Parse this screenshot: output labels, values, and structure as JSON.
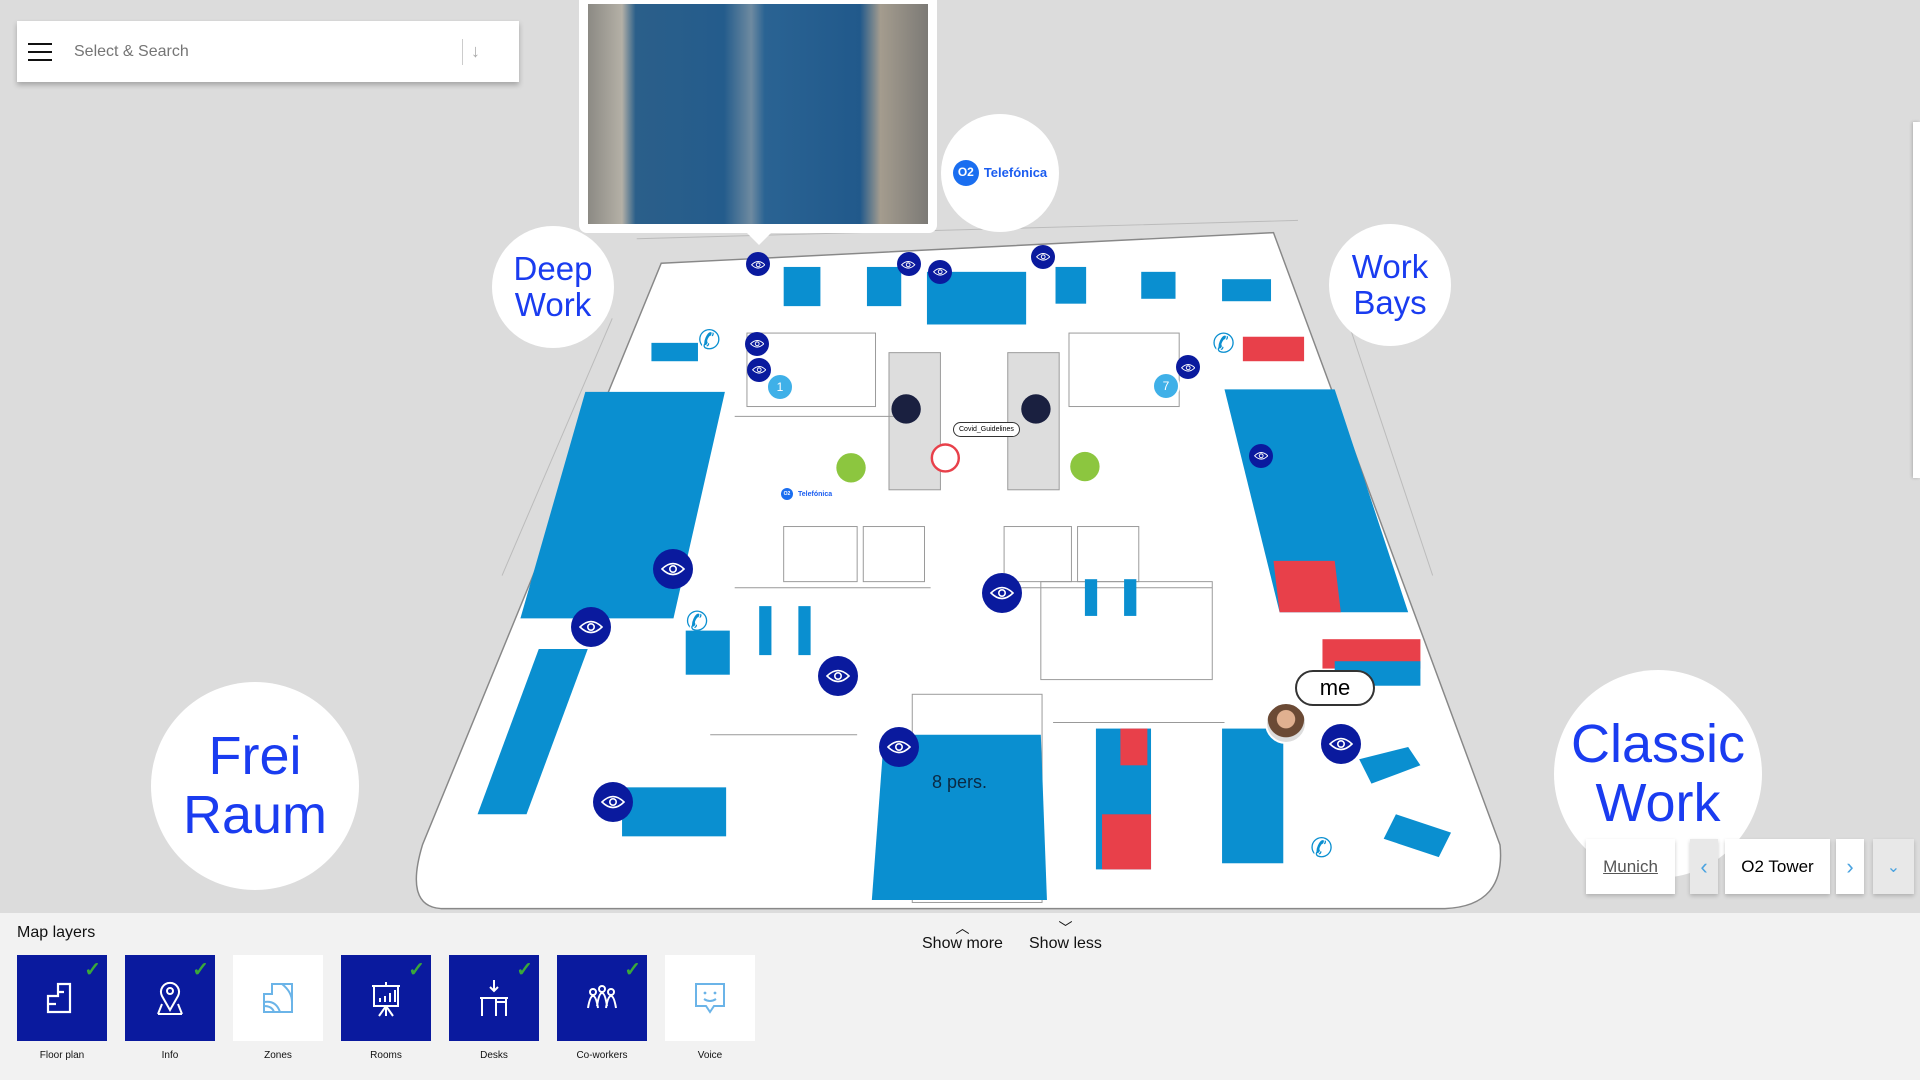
{
  "search": {
    "placeholder": "Select & Search"
  },
  "zones": {
    "deep_work": "Deep Work",
    "work_bays": "Work Bays",
    "frei_raum": "Frei Raum",
    "classic_work": "Classic Work"
  },
  "brand": {
    "o2_glyph": "O2",
    "name": "Telefónica"
  },
  "map": {
    "covid_label": "Covid_Guidelines",
    "room_capacity": "8 pers.",
    "badges": [
      "1",
      "7"
    ],
    "me_label": "me",
    "colors": {
      "zone_blue": "#0a8fd0",
      "occupied_red": "#e8404a",
      "marker": "#0a1a9e",
      "exit_green": "#8cc63f"
    }
  },
  "location": {
    "city": "Munich",
    "building": "O2 Tower"
  },
  "panel": {
    "title": "Map layers",
    "show_more": "Show more",
    "show_less": "Show less",
    "layers": [
      {
        "label": "Floor plan",
        "icon": "floor-plan-icon",
        "active": true
      },
      {
        "label": "Info",
        "icon": "map-pin-icon",
        "active": true
      },
      {
        "label": "Zones",
        "icon": "zones-icon",
        "active": false
      },
      {
        "label": "Rooms",
        "icon": "presentation-board-icon",
        "active": true
      },
      {
        "label": "Desks",
        "icon": "desk-icon",
        "active": true
      },
      {
        "label": "Co-workers",
        "icon": "people-icon",
        "active": true
      },
      {
        "label": "Voice",
        "icon": "chat-bubble-icon",
        "active": false
      }
    ]
  }
}
